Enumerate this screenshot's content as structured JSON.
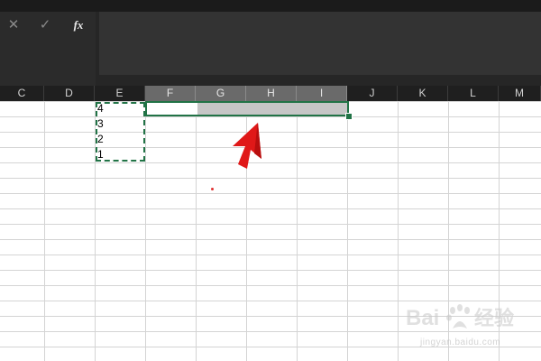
{
  "formula_bar": {
    "cancel_glyph": "✕",
    "enter_glyph": "✓",
    "function_label": "fx",
    "icons": [
      "close-icon",
      "checkmark-icon",
      "function-icon"
    ],
    "input_value": ""
  },
  "columns": [
    "C",
    "D",
    "E",
    "F",
    "G",
    "H",
    "I",
    "J",
    "K",
    "L",
    "M"
  ],
  "selected_columns": [
    "F",
    "G",
    "H",
    "I"
  ],
  "cells": {
    "E1": "4",
    "E2": "3",
    "E3": "2",
    "E4": "1"
  },
  "copied_range": "E1:E4",
  "selected_range": "F1:I1",
  "annotation": "red-arrow-pointing-at-selection",
  "watermark": {
    "logo": "Baidu 经验",
    "text": "jingyan.baidu.com"
  },
  "colors": {
    "accent": "#217346",
    "formula_bar_bg": "#262626",
    "header_bg": "#1f1f1f",
    "selected_header_bg": "#6a6a6a",
    "arrow": "#e01818"
  }
}
